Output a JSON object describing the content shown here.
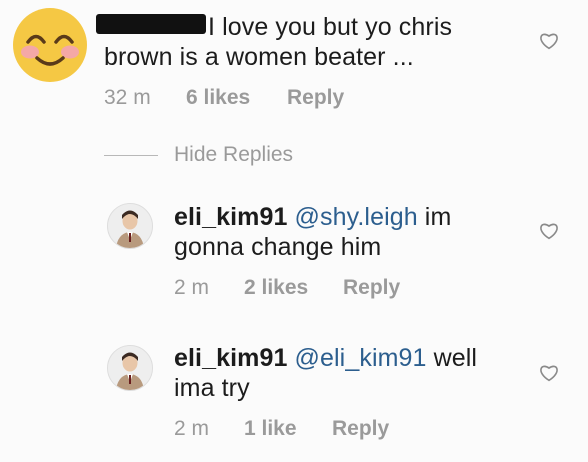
{
  "comments": [
    {
      "text_line1": "I love you but yo chris",
      "text_line2": "brown is a women beater ...",
      "time": "32 m",
      "likes": "6 likes",
      "reply_label": "Reply",
      "avatar_icon": "smiling-face-emoji"
    }
  ],
  "hide_replies_label": "Hide Replies",
  "replies": [
    {
      "username": "eli_kim91",
      "mention": "@shy.leigh",
      "text_line1_rest": " im",
      "text_line2": "gonna change him",
      "time": "2 m",
      "likes": "2 likes",
      "reply_label": "Reply"
    },
    {
      "username": "eli_kim91",
      "mention": "@eli_kim91",
      "text_line1_rest": " well",
      "text_line2": "ima try",
      "time": "2 m",
      "likes": "1 like",
      "reply_label": "Reply"
    }
  ],
  "colors": {
    "mention": "#2c5e8e",
    "meta": "#9a9a9a",
    "text": "#1c1c1c"
  }
}
